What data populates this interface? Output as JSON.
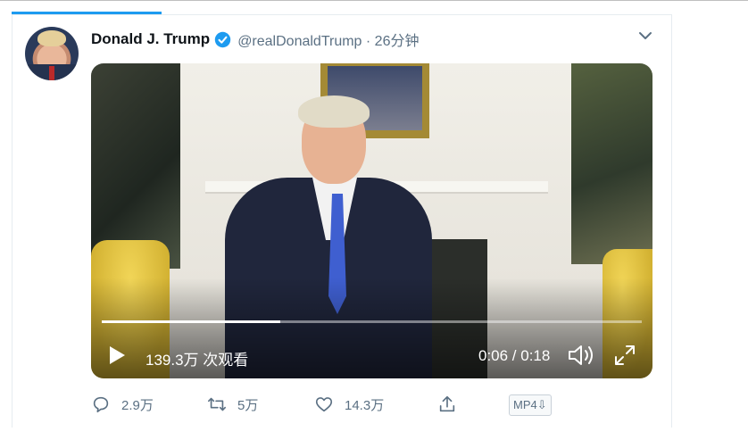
{
  "tweet": {
    "author_name": "Donald J. Trump",
    "handle_time": "@realDonaldTrump · 26分钟",
    "verified": true
  },
  "video": {
    "views": "139.3万 次观看",
    "time": "0:06 / 0:18",
    "progress_fraction": 0.33
  },
  "actions": {
    "reply_count": "2.9万",
    "retweet_count": "5万",
    "like_count": "14.3万",
    "download_label": "MP4⇩"
  },
  "icons": [
    "avatar",
    "verified-badge-icon",
    "chevron-down-icon",
    "play-icon",
    "volume-icon",
    "fullscreen-icon",
    "reply-icon",
    "retweet-icon",
    "like-icon",
    "share-icon"
  ],
  "colors": {
    "accent": "#1d9bf0",
    "muted": "#5b7083"
  }
}
